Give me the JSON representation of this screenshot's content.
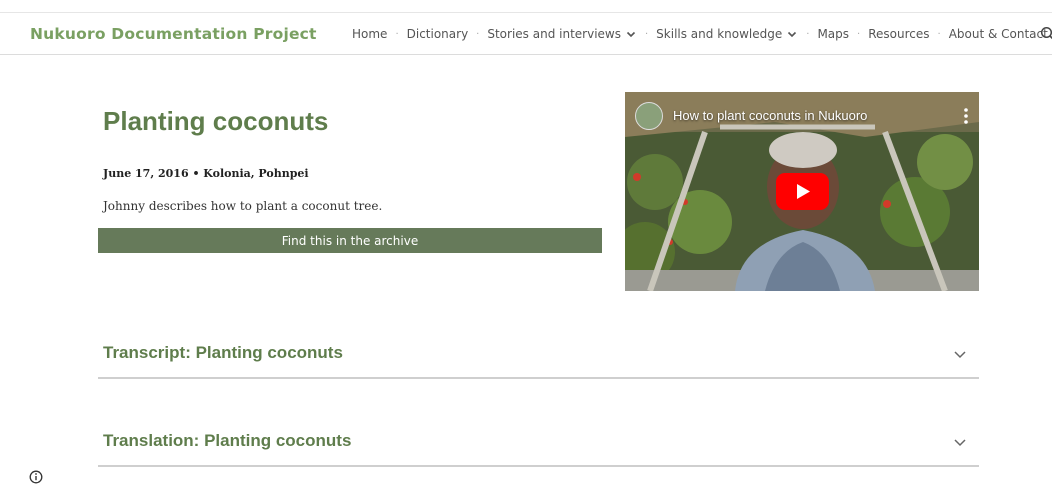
{
  "header": {
    "site_title": "Nukuoro Documentation Project",
    "nav": [
      {
        "label": "Home",
        "has_dropdown": false
      },
      {
        "label": "Dictionary",
        "has_dropdown": false
      },
      {
        "label": "Stories and interviews",
        "has_dropdown": true
      },
      {
        "label": "Skills and knowledge",
        "has_dropdown": true
      },
      {
        "label": "Maps",
        "has_dropdown": false
      },
      {
        "label": "Resources",
        "has_dropdown": false
      },
      {
        "label": "About & Contact",
        "has_dropdown": false
      }
    ],
    "search_icon": "search-icon"
  },
  "main": {
    "title": "Planting coconuts",
    "meta": "June 17, 2016 • Kolonia, Pohnpei",
    "description": "Johnny describes how to plant a coconut tree.",
    "archive_button": "Find this in the archive"
  },
  "video": {
    "title": "How to plant coconuts in Nukuoro",
    "play_icon": "youtube-play-icon"
  },
  "accordions": [
    {
      "title": "Transcript: Planting coconuts"
    },
    {
      "title": "Translation: Planting coconuts"
    }
  ],
  "colors": {
    "brand_green": "#7aa062",
    "heading_green": "#5f7d4c",
    "button_green": "#667a5a",
    "youtube_red": "#ff0000"
  }
}
